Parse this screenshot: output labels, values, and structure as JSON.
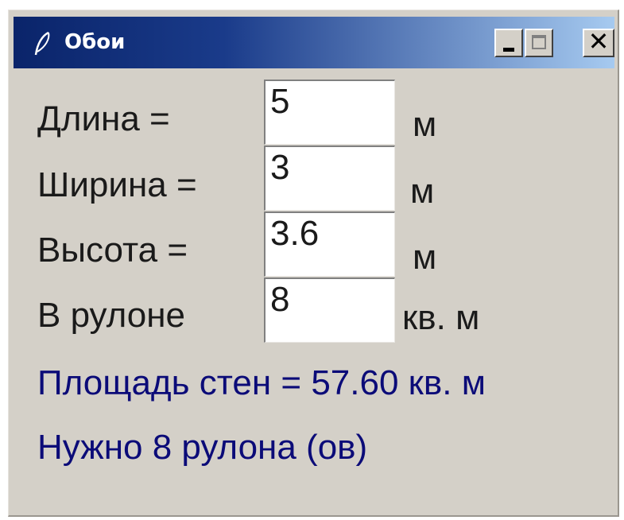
{
  "window": {
    "title": "Обои"
  },
  "fields": [
    {
      "label": "Длина =",
      "value": "5",
      "unit": "м"
    },
    {
      "label": "Ширина =",
      "value": "3",
      "unit": "м"
    },
    {
      "label": "Высота =",
      "value": "3.6",
      "unit": "м"
    },
    {
      "label": "В рулоне",
      "value": "8",
      "unit": "кв. м"
    }
  ],
  "results": {
    "area": "Площадь стен = 57.60 кв. м",
    "rolls": "Нужно  8 рулона (ов)"
  },
  "colors": {
    "title_gradient_start": "#0a246a",
    "title_gradient_end": "#a6caf0",
    "result_text": "#0b0b78",
    "window_bg": "#d4d0c8"
  },
  "icons": [
    "feather-icon",
    "minimize-icon",
    "maximize-icon",
    "close-icon"
  ]
}
